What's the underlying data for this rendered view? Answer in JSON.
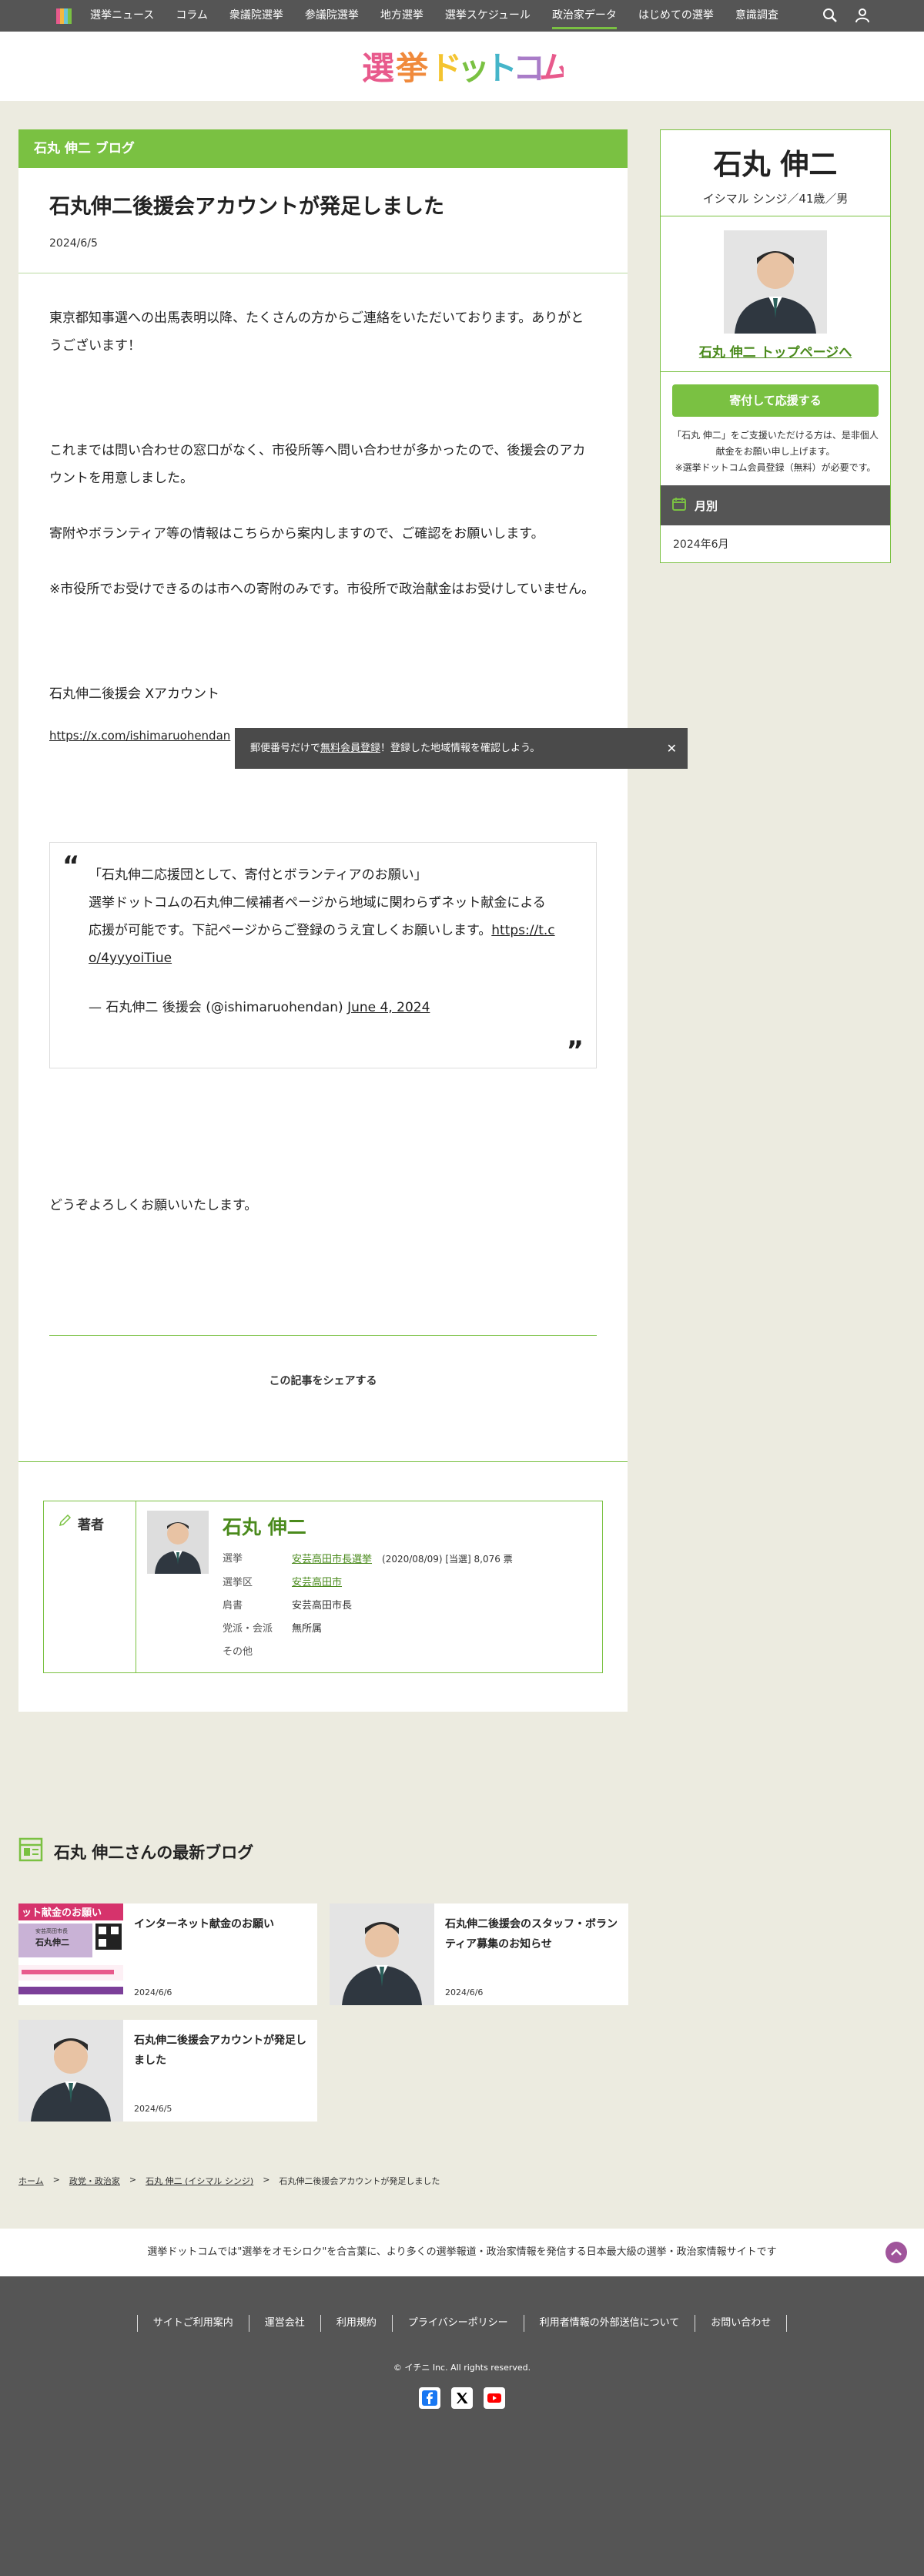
{
  "nav": {
    "items": [
      "選挙ニュース",
      "コラム",
      "衆議院選挙",
      "参議院選挙",
      "地方選挙",
      "選挙スケジュール",
      "政治家データ",
      "はじめての選挙",
      "意識調査"
    ],
    "active_index": 6
  },
  "brand": {
    "text": "選挙ドットコム"
  },
  "blog_band": "石丸 伸二 ブログ",
  "article": {
    "title": "石丸伸二後援会アカウントが発足しました",
    "date": "2024/6/5",
    "p1": "東京都知事選への出馬表明以降、たくさんの方からご連絡をいただいております。ありがとうございます！",
    "p2": "これまでは問い合わせの窓口がなく、市役所等へ問い合わせが多かったので、後援会のアカウントを用意しました。",
    "p3": "寄附やボランティア等の情報はこちらから案内しますので、ご確認をお願いします。",
    "p4": "※市役所でお受けできるのは市への寄附のみです。市役所で政治献金はお受けしていません。",
    "p5": "石丸伸二後援会 Xアカウント",
    "url": "https://x.com/ishimaruohendan",
    "quote": {
      "line1": "「石丸伸二応援団として、寄付とボランティアのお願い」",
      "line2": "選挙ドットコムの石丸伸二候補者ページから地域に関わらずネット献金による応援が可能です。下記ページからご登録のうえ宜しくお願いします。",
      "link": "https://t.co/4yyyoiTiue",
      "cite": "— 石丸伸二 後援会 (@ishimaruohendan)",
      "cite_date": "June 4, 2024"
    },
    "closing": "どうぞよろしくお願いいたします。",
    "share_label": "この記事をシェアする"
  },
  "author": {
    "label": "著者",
    "name": "石丸 伸二",
    "rows": [
      {
        "k": "選挙",
        "link": "安芸高田市長選挙",
        "v": "(2020/08/09) [当選] 8,076 票"
      },
      {
        "k": "選挙区",
        "link": "安芸高田市",
        "v": ""
      },
      {
        "k": "肩書",
        "link": "",
        "v": "安芸高田市長"
      },
      {
        "k": "党派・会派",
        "link": "",
        "v": "無所属"
      },
      {
        "k": "その他",
        "link": "",
        "v": ""
      }
    ]
  },
  "sidebar": {
    "name": "石丸 伸二",
    "kana": "イシマル シンジ／41歳／男",
    "top_link": "石丸 伸二 トップページへ",
    "donate": "寄付して応援する",
    "donate_note1": "「石丸 伸二」をご支援いただける方は、是非個人献金をお願い申し上げます。",
    "donate_note2": "※選挙ドットコム会員登録（無料）が必要です。",
    "monthly": "月別",
    "month": "2024年6月"
  },
  "latest": {
    "heading": "石丸 伸二さんの最新ブログ",
    "cards": [
      {
        "title": "インターネット献金のお願い",
        "date": "2024/6/6"
      },
      {
        "title": "石丸伸二後援会のスタッフ・ボランティア募集のお知らせ",
        "date": "2024/6/6"
      },
      {
        "title": "石丸伸二後援会アカウントが発足しました",
        "date": "2024/6/5"
      }
    ],
    "thumb1": {
      "banner": "ット献金のお願い",
      "sub": "安芸高田市長",
      "name": "石丸伸二"
    }
  },
  "breadcrumb": [
    "ホーム",
    "政党・政治家",
    "石丸 伸二 (イシマル シンジ)",
    "石丸伸二後援会アカウントが発足しました"
  ],
  "footer": {
    "tagline": "選挙ドットコムでは\"選挙をオモシロク\"を合言葉に、より多くの選挙報道・政治家情報を発信する日本最大級の選挙・政治家情報サイトです",
    "links": [
      "サイトご利用案内",
      "運営会社",
      "利用規約",
      "プライバシーポリシー",
      "利用者情報の外部送信について",
      "お問い合わせ"
    ],
    "copyright": "© イチニ Inc. All rights reserved."
  },
  "toast": {
    "prefix": "郵便番号だけで",
    "link": "無料会員登録",
    "suffix": "！登録した地域情報を確認しよう。"
  },
  "colors": {
    "accent": "#7ac142",
    "dark": "#555555",
    "link": "#4a8a1c"
  }
}
